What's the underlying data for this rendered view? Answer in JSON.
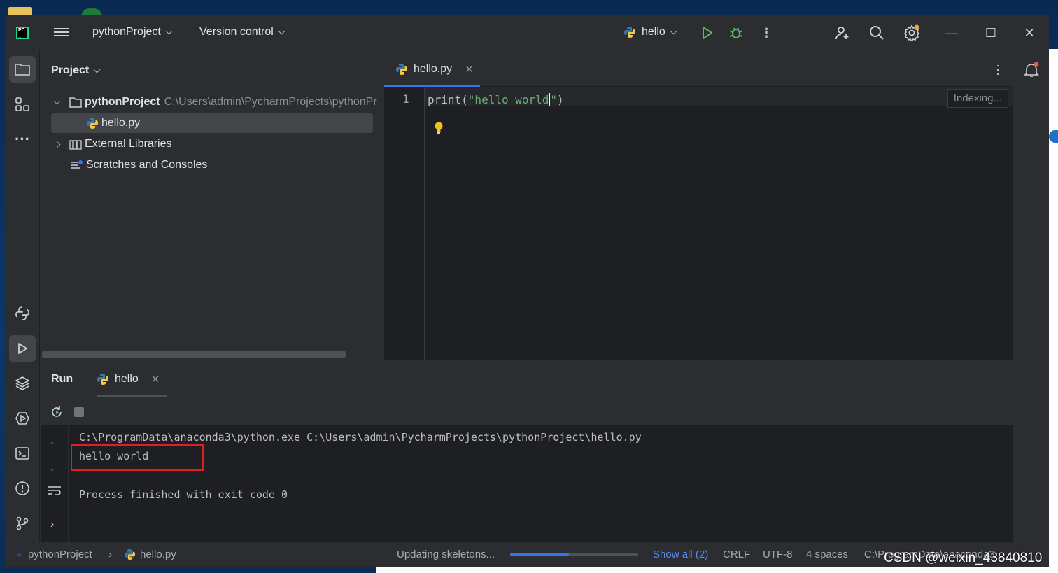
{
  "titlebar": {
    "project_label": "pythonProject",
    "vcs_label": "Version control",
    "run_config": "hello"
  },
  "project_panel": {
    "title": "Project",
    "root_name": "pythonProject",
    "root_path": "C:\\Users\\admin\\PycharmProjects\\pythonPr",
    "items": [
      {
        "label": "hello.py"
      },
      {
        "label": "External Libraries"
      },
      {
        "label": "Scratches and Consoles"
      }
    ]
  },
  "editor": {
    "tab_label": "hello.py",
    "line_number": "1",
    "code_prefix": "print(",
    "code_string_before_caret": "\"hello world",
    "code_string_after_caret": "\"",
    "code_suffix": ")",
    "indexing_label": "Indexing..."
  },
  "run_panel": {
    "title": "Run",
    "tab_label": "hello",
    "console_lines": [
      "C:\\ProgramData\\anaconda3\\python.exe C:\\Users\\admin\\PycharmProjects\\pythonProject\\hello.py",
      "hello world",
      "",
      "Process finished with exit code 0"
    ],
    "highlight_color": "#e0201e"
  },
  "statusbar": {
    "breadcrumb_project": "pythonProject",
    "breadcrumb_file": "hello.py",
    "task": "Updating skeletons...",
    "progress": 0.46,
    "show_all": "Show all (2)",
    "line_sep": "CRLF",
    "encoding": "UTF-8",
    "indent": "4 spaces",
    "interpreter": "C:\\ProgramData\\anaconda3"
  },
  "watermark": "CSDN @weixin_43840810",
  "colors": {
    "accent": "#3574f0",
    "run_green": "#5fb865",
    "string_green": "#6aab73"
  }
}
